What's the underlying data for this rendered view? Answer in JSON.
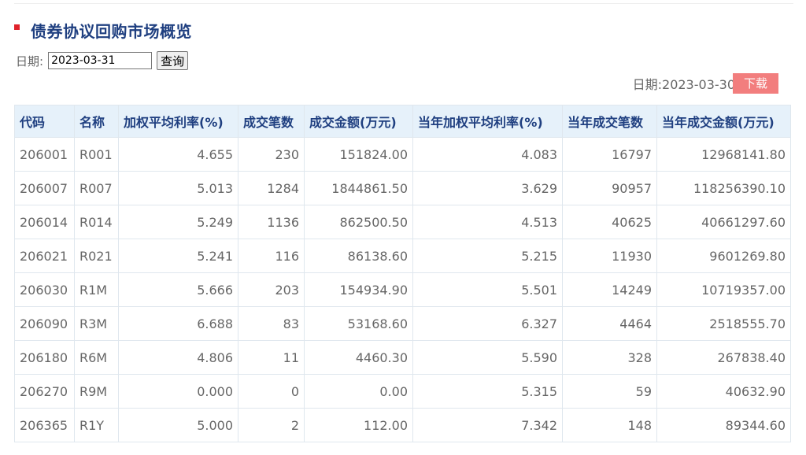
{
  "page": {
    "title": "债券协议回购市场概览",
    "query_label": "日期:",
    "query_date": "2023-03-31",
    "query_button": "查询",
    "data_date_label": "日期:",
    "data_date": "2023-03-30",
    "download_button": "下载",
    "accent_color": "#e0232b",
    "title_color": "#1f3f80"
  },
  "table": {
    "headers": [
      "代码",
      "名称",
      "加权平均利率(%)",
      "成交笔数",
      "成交金额(万元)",
      "当年加权平均利率(%)",
      "当年成交笔数",
      "当年成交金额(万元)"
    ],
    "rows": [
      [
        "206001",
        "R001",
        "4.655",
        "230",
        "151824.00",
        "4.083",
        "16797",
        "12968141.80"
      ],
      [
        "206007",
        "R007",
        "5.013",
        "1284",
        "1844861.50",
        "3.629",
        "90957",
        "118256390.10"
      ],
      [
        "206014",
        "R014",
        "5.249",
        "1136",
        "862500.50",
        "4.513",
        "40625",
        "40661297.60"
      ],
      [
        "206021",
        "R021",
        "5.241",
        "116",
        "86138.60",
        "5.215",
        "11930",
        "9601269.80"
      ],
      [
        "206030",
        "R1M",
        "5.666",
        "203",
        "154934.90",
        "5.501",
        "14249",
        "10719357.00"
      ],
      [
        "206090",
        "R3M",
        "6.688",
        "83",
        "53168.60",
        "6.327",
        "4464",
        "2518555.70"
      ],
      [
        "206180",
        "R6M",
        "4.806",
        "11",
        "4460.30",
        "5.590",
        "328",
        "267838.40"
      ],
      [
        "206270",
        "R9M",
        "0.000",
        "0",
        "0.00",
        "5.315",
        "59",
        "40632.90"
      ],
      [
        "206365",
        "R1Y",
        "5.000",
        "2",
        "112.00",
        "7.342",
        "148",
        "89344.60"
      ]
    ]
  }
}
